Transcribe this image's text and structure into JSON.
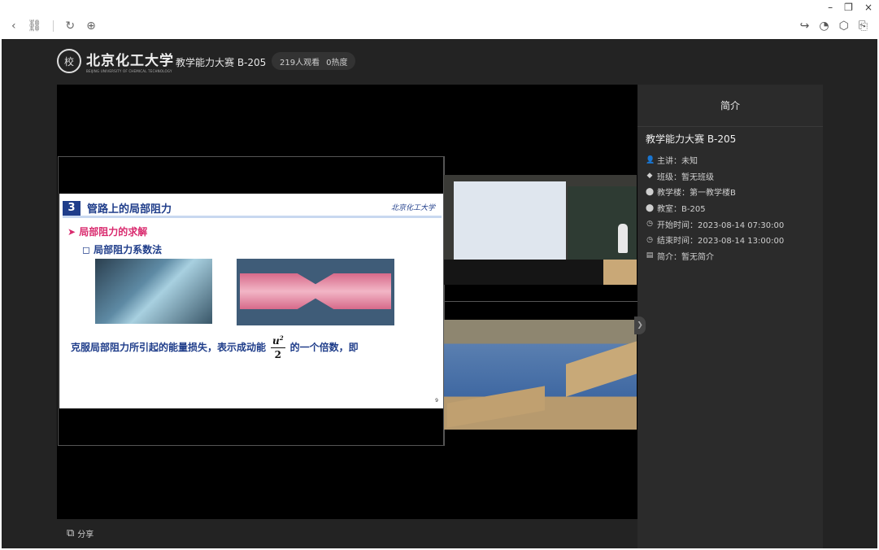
{
  "window": {
    "minimize": "–",
    "restore": "❐",
    "close": "×"
  },
  "nav": {
    "back": "‹",
    "link": "⛓",
    "refresh": "↻",
    "globe": "⊕"
  },
  "tools": {
    "share": "↪",
    "comment": "◔",
    "box": "⬡",
    "export": "⎘"
  },
  "header": {
    "logo_text": "北京化工大学",
    "logo_sub": "BEIJING UNIVERSITY OF CHEMICAL TECHNOLOGY",
    "logo_seal": "校",
    "title": "教学能力大赛 B-205",
    "viewers": "219人观看",
    "heat": "0热度"
  },
  "slide": {
    "number": "3",
    "title": "管路上的局部阻力",
    "logo": "北京化工大学",
    "bullet1": "➤ 局部阻力的求解",
    "bullet2": "◻ 局部阻力系数法",
    "formula_text1": "克服局部阻力所引起的能量损失，表示成动能",
    "formula_num": "u",
    "formula_sup": "2",
    "formula_den": "2",
    "formula_text2": "的一个倍数，即",
    "page": "9"
  },
  "sidepanel": {
    "title": "简介",
    "name": "教学能力大赛 B-205",
    "items": [
      {
        "icon": "👤",
        "text": "主讲：未知"
      },
      {
        "icon": "◆",
        "text": "班级：暂无班级"
      },
      {
        "icon": "⬤",
        "text": "教学楼：第一教学楼B"
      },
      {
        "icon": "⬤",
        "text": "教室：B-205"
      },
      {
        "icon": "◷",
        "text": "开始时间：2023-08-14 07:30:00"
      },
      {
        "icon": "◷",
        "text": "结束时间：2023-08-14 13:00:00"
      },
      {
        "icon": "▤",
        "text": "简介：暂无简介"
      }
    ]
  },
  "footer": {
    "share": "分享"
  }
}
